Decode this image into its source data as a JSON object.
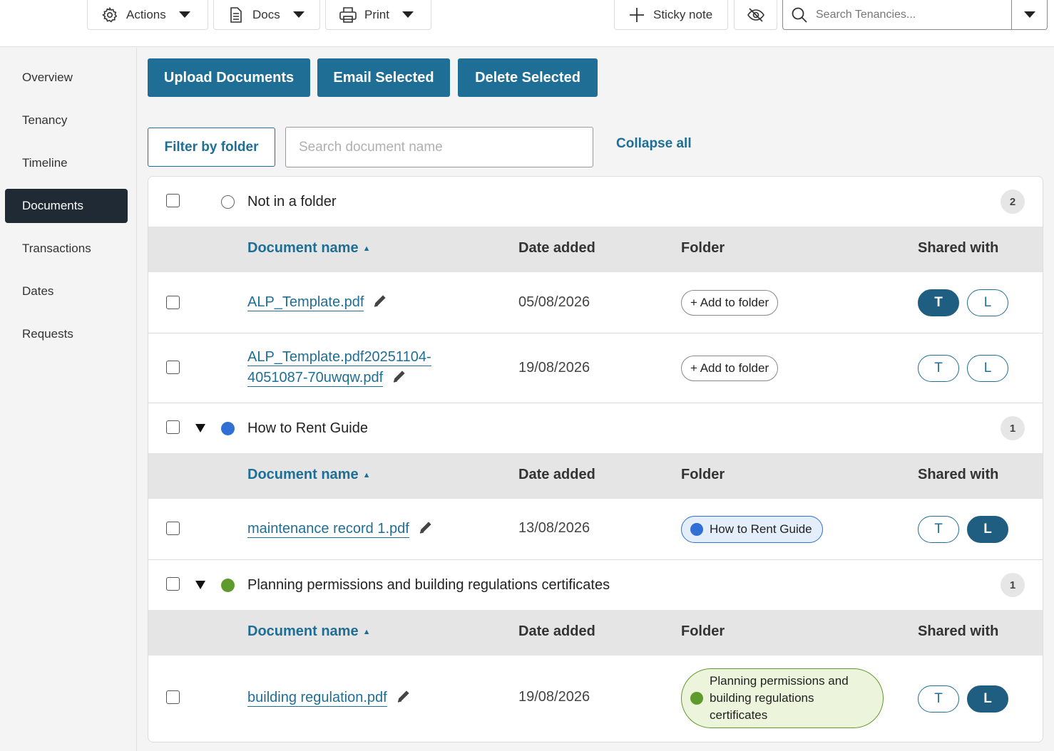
{
  "toolbar": {
    "actions_label": "Actions",
    "docs_label": "Docs",
    "print_label": "Print",
    "sticky_label": "Sticky note",
    "search_placeholder": "Search Tenancies..."
  },
  "sidebar": {
    "items": [
      {
        "label": "Overview"
      },
      {
        "label": "Tenancy"
      },
      {
        "label": "Timeline"
      },
      {
        "label": "Documents",
        "active": true
      },
      {
        "label": "Transactions"
      },
      {
        "label": "Dates"
      },
      {
        "label": "Requests"
      }
    ]
  },
  "main": {
    "upload_label": "Upload Documents",
    "email_label": "Email Selected",
    "delete_label": "Delete Selected",
    "filter_label": "Filter by folder",
    "doc_search_placeholder": "Search document name",
    "collapse_label": "Collapse all"
  },
  "columns": {
    "name": "Document name",
    "date": "Date added",
    "folder": "Folder",
    "shared": "Shared with"
  },
  "share_labels": {
    "tenant": "T",
    "landlord": "L"
  },
  "add_folder_label": "+ Add to folder",
  "folders": [
    {
      "title": "Not in a folder",
      "count": "2",
      "docs": [
        {
          "name": "ALP_Template.pdf",
          "date": "05/08/2026",
          "tenant_shared": true,
          "landlord_shared": false
        },
        {
          "name_line1": "ALP_Template.pdf20251104-",
          "name_line2": "4051087-70uwqw.pdf",
          "date": "19/08/2026",
          "tenant_shared": false,
          "landlord_shared": false
        }
      ]
    },
    {
      "title": "How to Rent Guide",
      "count": "1",
      "color": "#2f6fd6",
      "docs": [
        {
          "name": "maintenance record 1.pdf",
          "date": "13/08/2026",
          "folder_chip": "How to Rent Guide",
          "tenant_shared": false,
          "landlord_shared": true
        }
      ]
    },
    {
      "title": "Planning permissions and building regulations certificates",
      "count": "1",
      "color": "#5f9a2c",
      "docs": [
        {
          "name": "building regulation.pdf",
          "date": "19/08/2026",
          "folder_chip_lines": [
            "Planning permissions and",
            "building regulations",
            "certificates"
          ],
          "tenant_shared": false,
          "landlord_shared": true
        }
      ]
    }
  ]
}
